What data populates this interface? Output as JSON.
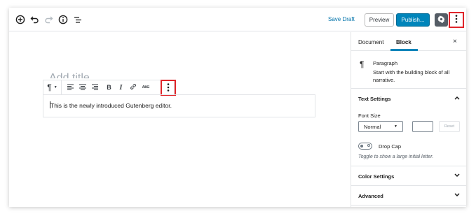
{
  "toolbar": {
    "save_draft": "Save Draft",
    "preview": "Preview",
    "publish": "Publish...",
    "icons": [
      "add-block-icon",
      "undo-icon",
      "redo-icon",
      "info-icon",
      "outline-icon",
      "gear-icon",
      "more-options-icon"
    ]
  },
  "editor": {
    "title_placeholder": "Add title",
    "paragraph_text": "This is the newly introduced Gutenberg editor.",
    "block_toolbar": {
      "paragraph_glyph": "¶",
      "bold": "B",
      "italic": "I",
      "strikethrough": "ABC"
    }
  },
  "sidebar": {
    "tabs": [
      "Document",
      "Block"
    ],
    "active_tab": "Block",
    "close": "×",
    "block_card": {
      "icon": "¶",
      "title": "Paragraph",
      "description": "Start with the building block of all narrative."
    },
    "text_settings": {
      "heading": "Text Settings",
      "font_size_label": "Font Size",
      "font_size_value": "Normal",
      "reset": "Reset",
      "drop_cap_label": "Drop Cap",
      "drop_cap_help": "Toggle to show a large initial letter."
    },
    "color_settings": "Color Settings",
    "advanced": "Advanced"
  },
  "colors": {
    "accent": "#0085ba",
    "link": "#0073aa",
    "highlight": "#e0252a"
  }
}
